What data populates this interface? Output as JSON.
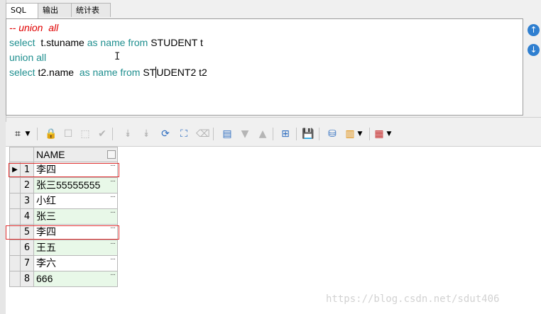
{
  "tabs": [
    {
      "label": "SQL",
      "active": true
    },
    {
      "label": "输出",
      "active": false
    },
    {
      "label": "统计表",
      "active": false
    }
  ],
  "editor": {
    "lines": [
      [
        {
          "text": "-- union  all",
          "style": "cm"
        }
      ],
      [
        {
          "text": "select",
          "style": "kw"
        },
        {
          "text": "  t.stuname ",
          "style": ""
        },
        {
          "text": "as name from",
          "style": "kw"
        },
        {
          "text": " STUDENT t",
          "style": ""
        }
      ],
      [
        {
          "text": "union all",
          "style": "kw"
        }
      ],
      [
        {
          "text": "select",
          "style": "kw"
        },
        {
          "text": " t2.name  ",
          "style": ""
        },
        {
          "text": "as name from",
          "style": "kw"
        },
        {
          "text": " ST",
          "style": ""
        },
        {
          "text": "",
          "style": "cursor"
        },
        {
          "text": "UDENT2 t2",
          "style": ""
        }
      ]
    ]
  },
  "side_buttons": {
    "up_icon": "↑",
    "down_icon": "↓"
  },
  "toolbar": {
    "icons": {
      "grid_icon": "⌗",
      "lock_icon": "🔒",
      "filter_down_icon": "⯯",
      "refresh_icon": "⟳",
      "search_icon": "⌕",
      "eraser_icon": "⌫",
      "query_icon": "▤",
      "arrow_down_icon": "▼",
      "arrow_up_icon": "▲",
      "tree_icon": "⊞",
      "save_icon": "💾",
      "db_icon": "⛁",
      "chart_icon": "▥",
      "table_icon": "▦"
    },
    "colors": {
      "lock": "#c0282d",
      "save": "#7a2f8e",
      "chart": "#e08a00",
      "table": "#c62828",
      "blue": "#2f6ec0"
    }
  },
  "grid": {
    "column_header": "NAME",
    "rows": [
      {
        "n": "1",
        "name": "李四",
        "highlight": true,
        "current": true
      },
      {
        "n": "2",
        "name": "张三55555555",
        "highlight": false,
        "current": false
      },
      {
        "n": "3",
        "name": "小红",
        "highlight": false,
        "current": false
      },
      {
        "n": "4",
        "name": "张三",
        "highlight": false,
        "current": false
      },
      {
        "n": "5",
        "name": "李四",
        "highlight": true,
        "current": false
      },
      {
        "n": "6",
        "name": "王五",
        "highlight": false,
        "current": false
      },
      {
        "n": "7",
        "name": "李六",
        "highlight": false,
        "current": false
      },
      {
        "n": "8",
        "name": "666",
        "highlight": false,
        "current": false
      }
    ],
    "ellipsis": "···",
    "current_marker": "▶"
  },
  "watermark": "https://blog.csdn.net/sdut406"
}
